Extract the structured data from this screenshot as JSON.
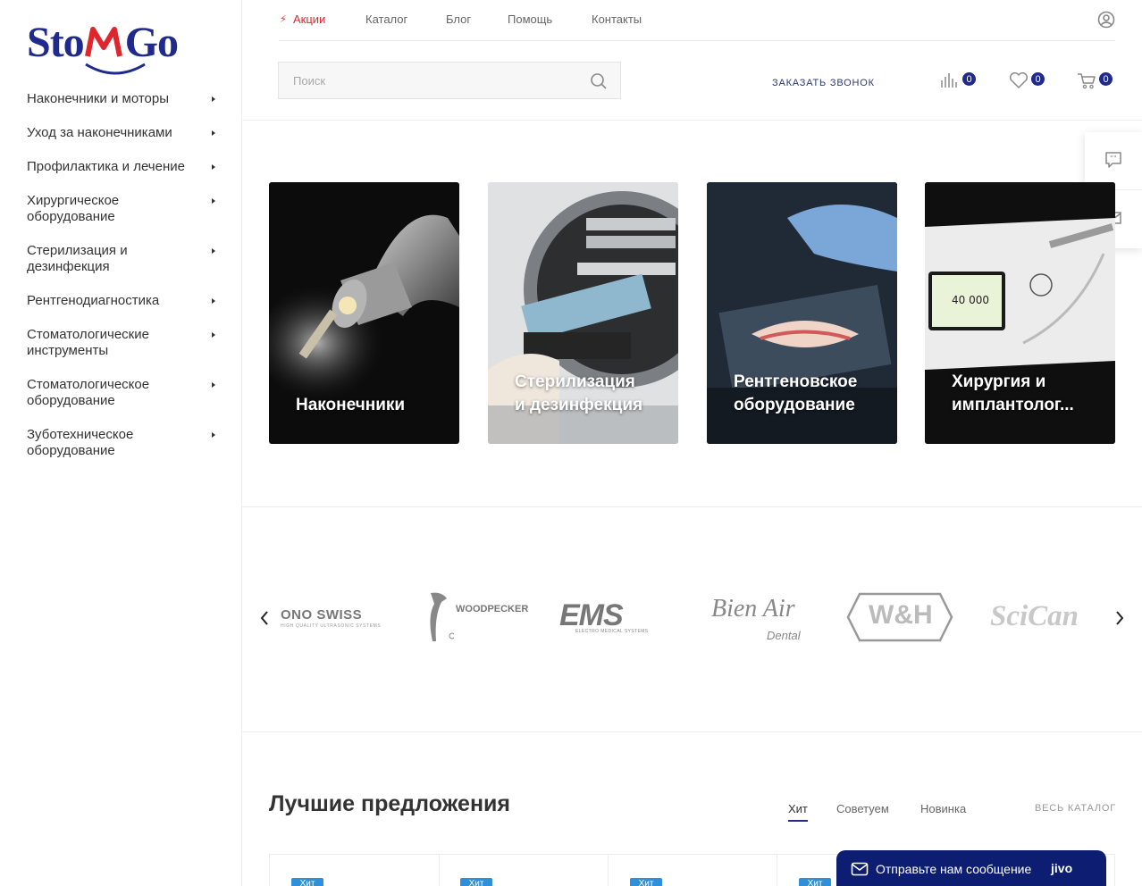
{
  "logo": {
    "part1": "Sto",
    "part2": "Go"
  },
  "sidebar": {
    "items": [
      {
        "label": "Наконечники и моторы"
      },
      {
        "label": "Уход за наконечниками"
      },
      {
        "label": "Профилактика и лечение"
      },
      {
        "label": "Хирургическое оборудование"
      },
      {
        "label": "Стерилизация и дезинфекция"
      },
      {
        "label": "Рентгенодиагностика"
      },
      {
        "label": "Стоматологические инструменты"
      },
      {
        "label": "Стоматологическое оборудование"
      },
      {
        "label": "Зуботехническое оборудование"
      }
    ]
  },
  "topnav": {
    "promo": "Акции",
    "catalog": "Каталог",
    "blog": "Блог",
    "help": "Помощь",
    "contacts": "Контакты"
  },
  "search": {
    "placeholder": "Поиск"
  },
  "header": {
    "callback": "ЗАКАЗАТЬ ЗВОНОК",
    "compare_count": "0",
    "favorites_count": "0",
    "cart_count": "0"
  },
  "categories": [
    {
      "label": "Наконечники"
    },
    {
      "label": "Стерилизация\nи дезинфекция"
    },
    {
      "label": "Рентгеновское\nоборудование"
    },
    {
      "label": "Хирургия и\nимплантолог..."
    }
  ],
  "tile_display_text": "40 000",
  "brands": [
    {
      "name": "ONO SWISS",
      "sub": "HIGH QUALITY ULTRASONIC SYSTEMS"
    },
    {
      "name": "WOODPECKER"
    },
    {
      "name": "EMS",
      "sub": "ELECTRO MEDICAL SYSTEMS"
    },
    {
      "name": "Bien Air",
      "sub": "Dental"
    },
    {
      "name": "W&H"
    },
    {
      "name": "SciCan"
    }
  ],
  "offers": {
    "title": "Лучшие предложения",
    "tabs": [
      "Хит",
      "Советуем",
      "Новинка"
    ],
    "all_catalog": "ВЕСЬ КАТАЛОГ",
    "badge": "Хит"
  },
  "chat": {
    "text": "Отправьте нам сообщение",
    "brand": "jivo"
  },
  "colors": {
    "brand_blue": "#1f2a8c",
    "accent_red": "#e0262d",
    "badge_blue": "#2f8fd8",
    "chat_bg": "#0d1e72"
  }
}
